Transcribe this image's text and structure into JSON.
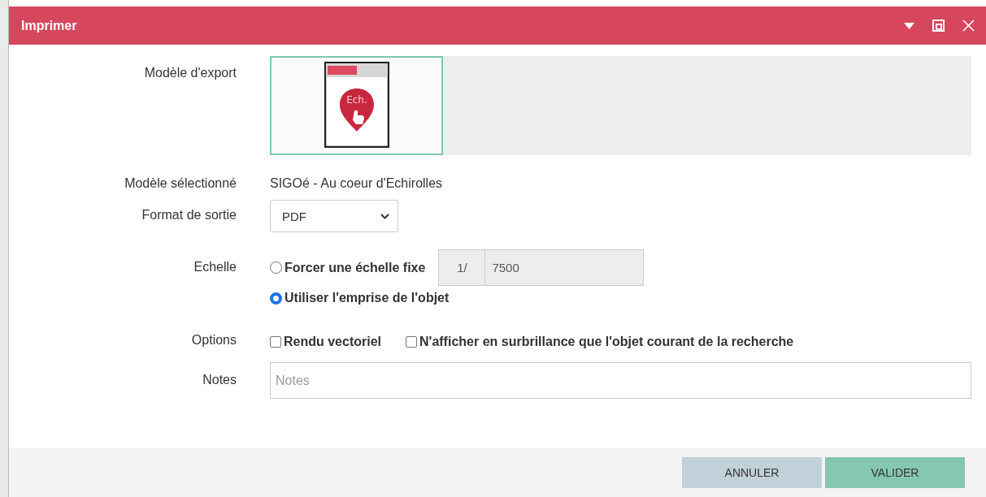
{
  "window": {
    "title": "Imprimer"
  },
  "export_models": {
    "label": "Modèle d'export",
    "items": [
      {
        "logo_text": "Ech.",
        "selected": true
      }
    ]
  },
  "selected_model": {
    "label": "Modèle sélectionné",
    "value": "SIGOé - Au coeur d'Echirolles"
  },
  "output_format": {
    "label": "Format de sortie",
    "value": "PDF"
  },
  "scale": {
    "label": "Echelle",
    "options": [
      {
        "kind": "fixed",
        "label": "Forcer une échelle fixe",
        "selected": false,
        "prefix": "1/",
        "value": "7500"
      },
      {
        "kind": "extent",
        "label": "Utiliser l'emprise de l'objet",
        "selected": true
      }
    ]
  },
  "options": {
    "label": "Options",
    "items": [
      {
        "label": "Rendu vectoriel",
        "checked": false
      },
      {
        "label": "N'afficher en surbrillance que l'objet courant de la recherche",
        "checked": false
      }
    ]
  },
  "notes": {
    "label": "Notes",
    "placeholder": "Notes"
  },
  "buttons": [
    {
      "label": "ANNULER",
      "kind": "cancel"
    },
    {
      "label": "VALIDER",
      "kind": "primary"
    }
  ]
}
